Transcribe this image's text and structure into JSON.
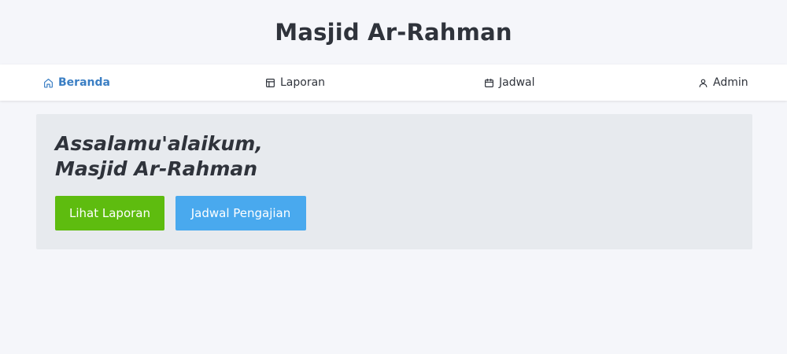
{
  "header": {
    "title": "Masjid Ar-Rahman"
  },
  "nav": {
    "items": [
      {
        "label": "Beranda",
        "icon": "home-icon",
        "active": true
      },
      {
        "label": "Laporan",
        "icon": "layout-icon",
        "active": false
      },
      {
        "label": "Jadwal",
        "icon": "calendar-icon",
        "active": false
      },
      {
        "label": "Admin",
        "icon": "user-icon",
        "active": false
      }
    ]
  },
  "hero": {
    "greeting_line1": "Assalamu'alaikum,",
    "greeting_line2": "Masjid Ar-Rahman",
    "primary_button": "Lihat Laporan",
    "secondary_button": "Jadwal Pengajian"
  },
  "colors": {
    "accent": "#3b7fc4",
    "primary_button": "#5ebc0f",
    "secondary_button": "#49a9ee",
    "hero_background": "#e7eaee",
    "page_background": "#f5f6fa"
  }
}
